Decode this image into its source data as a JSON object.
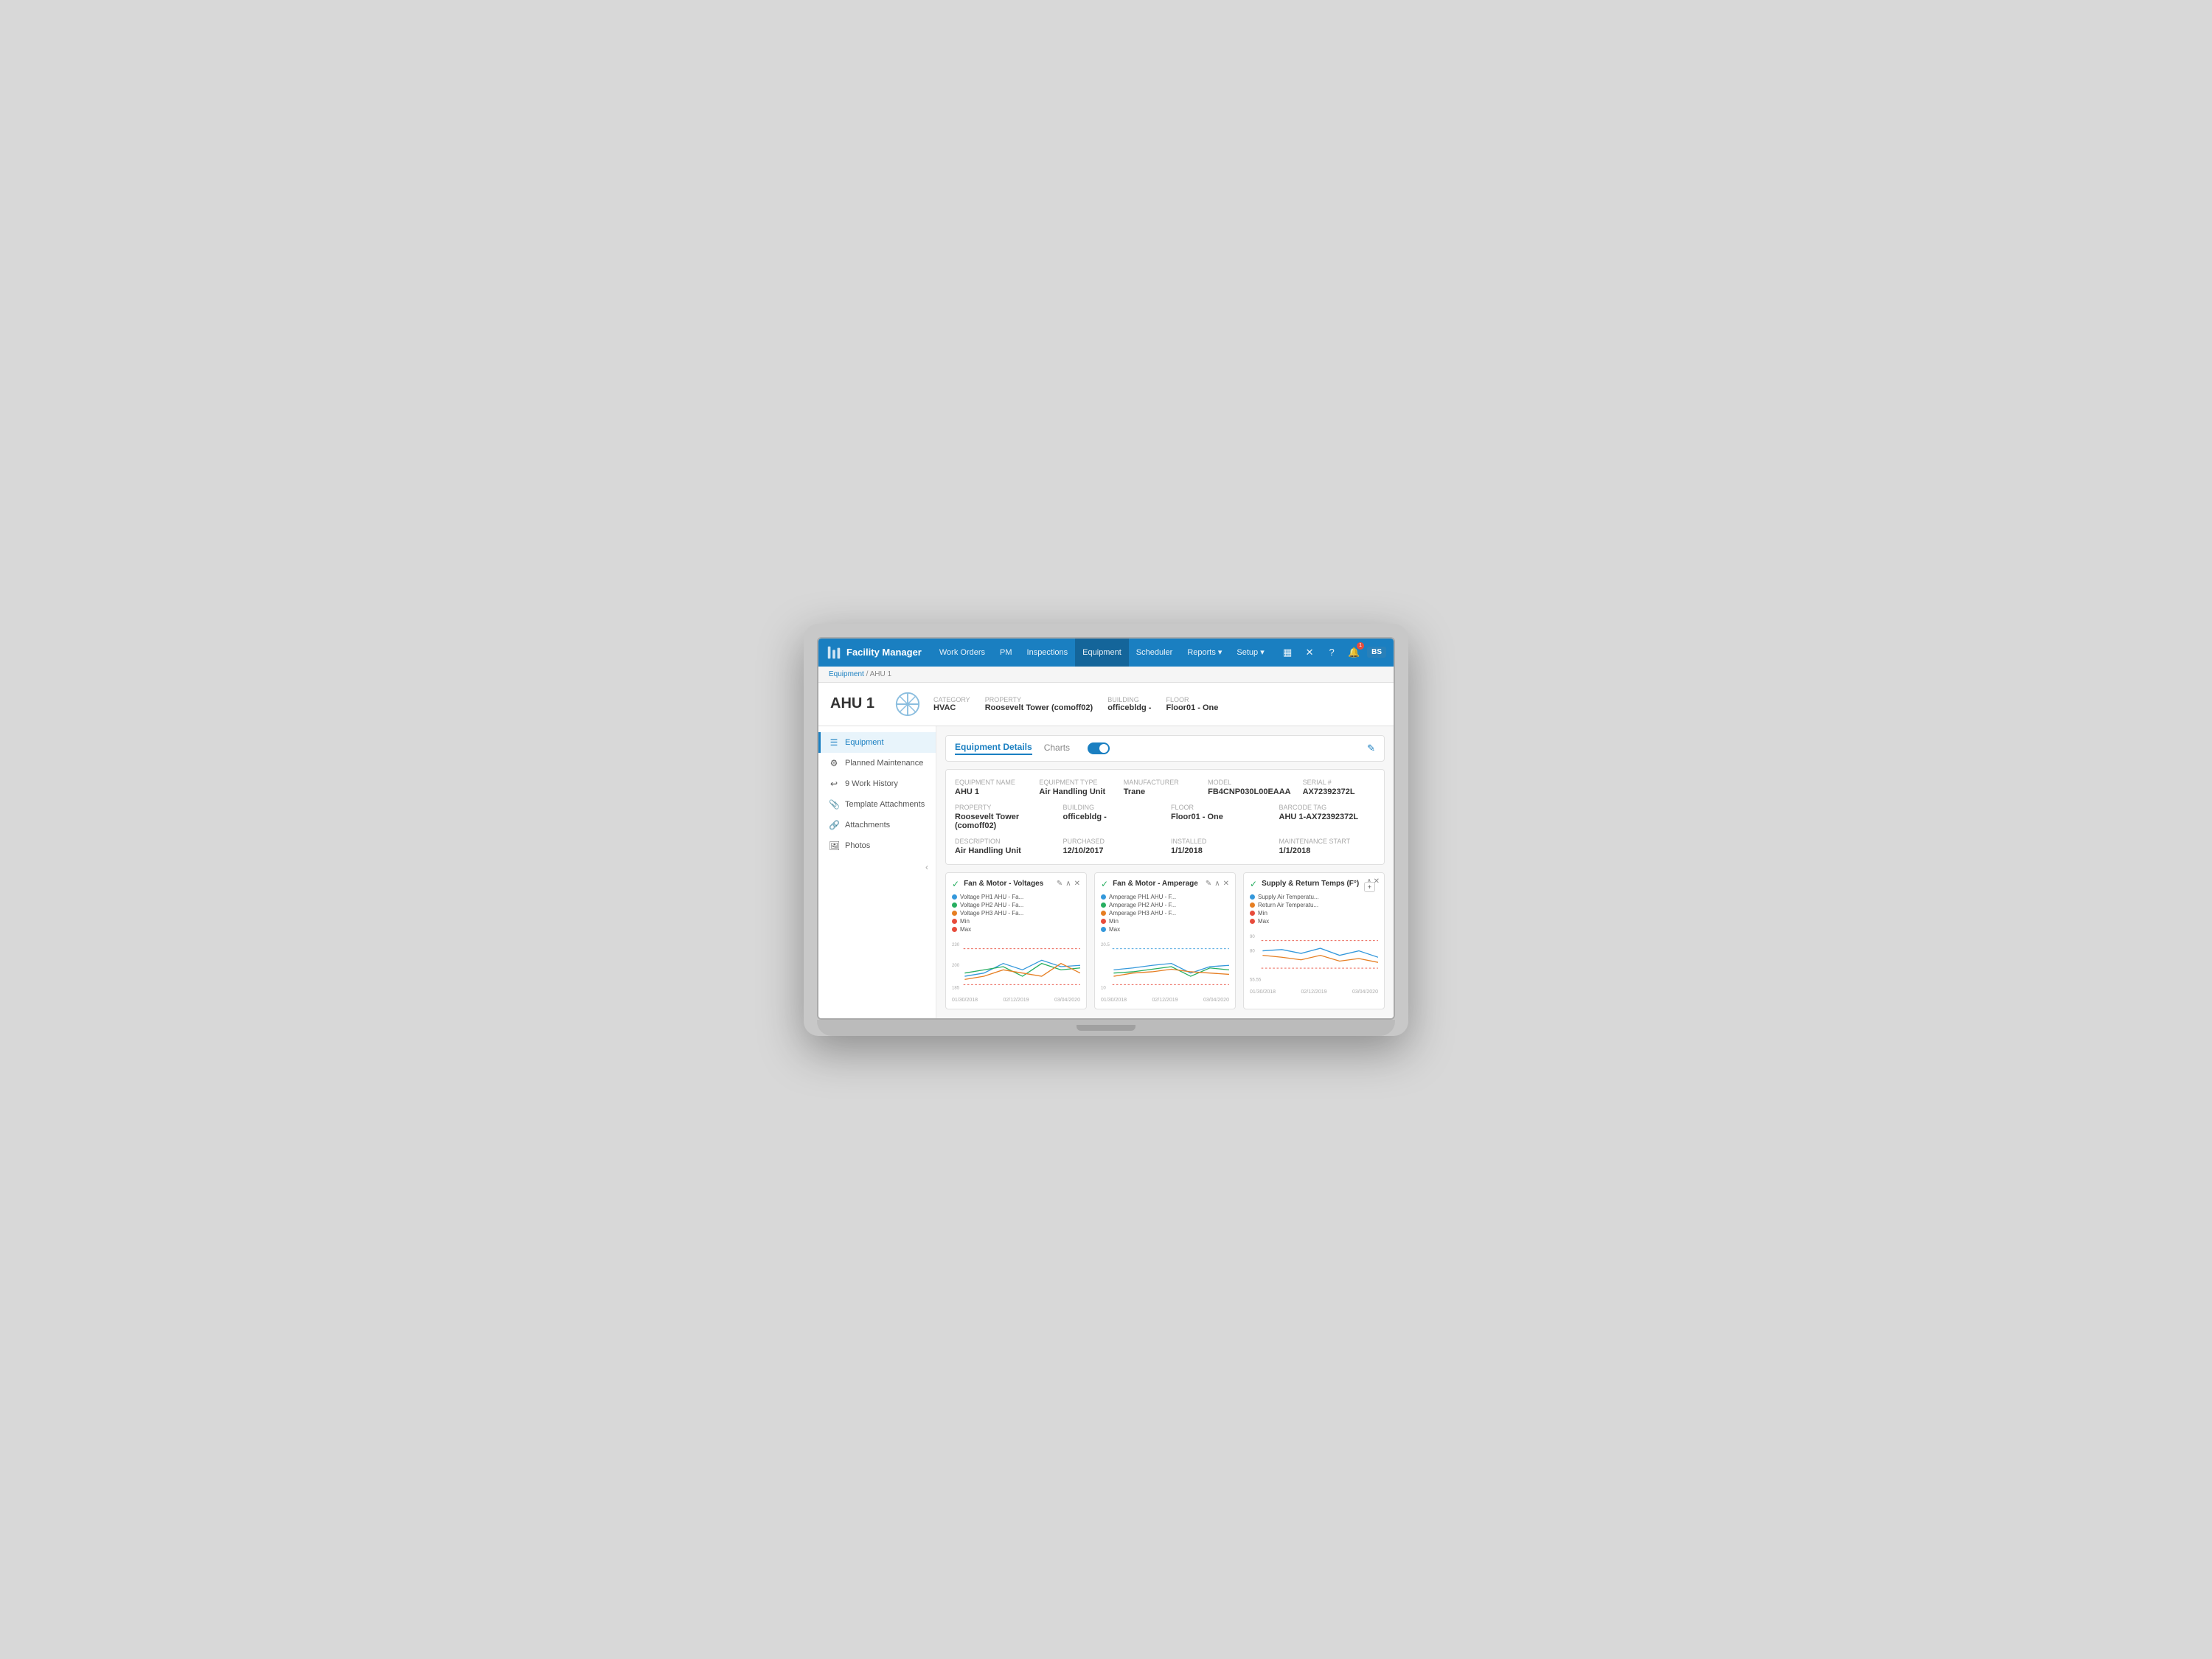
{
  "app": {
    "brand": "Facility Manager",
    "brand_icon": "⛃"
  },
  "nav": {
    "links": [
      {
        "label": "Work Orders",
        "active": false
      },
      {
        "label": "PM",
        "active": false
      },
      {
        "label": "Inspections",
        "active": false
      },
      {
        "label": "Equipment",
        "active": true
      },
      {
        "label": "Scheduler",
        "active": false
      },
      {
        "label": "Reports ▾",
        "active": false
      },
      {
        "label": "Setup ▾",
        "active": false
      }
    ],
    "icons": [
      "▦",
      "✕",
      "?"
    ],
    "notification_count": "1",
    "user_initials": "BS"
  },
  "breadcrumb": {
    "parent": "Equipment",
    "separator": " / ",
    "current": "AHU 1"
  },
  "equipment_header": {
    "title": "AHU 1",
    "category_label": "Category",
    "category_value": "HVAC",
    "property_label": "Property",
    "property_value": "Roosevelt Tower (comoff02)",
    "building_label": "Building",
    "building_value": "officebldg -",
    "floor_label": "Floor",
    "floor_value": "Floor01 - One"
  },
  "sidebar": {
    "items": [
      {
        "label": "Equipment",
        "icon": "☰",
        "active": true
      },
      {
        "label": "Planned Maintenance",
        "icon": "⚙",
        "active": false
      },
      {
        "label": "9 Work History",
        "icon": "↩",
        "active": false
      },
      {
        "label": "Template Attachments",
        "icon": "📎",
        "active": false
      },
      {
        "label": "Attachments",
        "icon": "🔗",
        "active": false
      },
      {
        "label": "Photos",
        "icon": "🖼",
        "active": false
      }
    ],
    "collapse_icon": "‹"
  },
  "tabs": {
    "items": [
      {
        "label": "Equipment Details",
        "active": true
      },
      {
        "label": "Charts",
        "active": false
      }
    ],
    "charts_toggle": true,
    "edit_icon": "✎"
  },
  "details": {
    "row1": [
      {
        "label": "Equipment Name",
        "value": "AHU 1"
      },
      {
        "label": "Equipment Type",
        "value": "Air Handling Unit"
      },
      {
        "label": "Manufacturer",
        "value": "Trane"
      },
      {
        "label": "Model",
        "value": "FB4CNP030L00EAAA"
      },
      {
        "label": "Serial #",
        "value": "AX72392372L"
      }
    ],
    "row2": [
      {
        "label": "Property",
        "value": "Roosevelt Tower (comoff02)"
      },
      {
        "label": "Building",
        "value": "officebldg -"
      },
      {
        "label": "Floor",
        "value": "Floor01 - One"
      },
      {
        "label": "Barcode Tag",
        "value": "AHU 1-AX72392372L"
      }
    ],
    "row3": [
      {
        "label": "Description",
        "value": "Air Handling Unit"
      },
      {
        "label": "Purchased",
        "value": "12/10/2017"
      },
      {
        "label": "Installed",
        "value": "1/1/2018"
      },
      {
        "label": "Maintenance Start",
        "value": "1/1/2018"
      }
    ]
  },
  "charts": [
    {
      "id": "chart1",
      "status": "✓",
      "title": "Fan & Motor - Voltages",
      "legend": [
        {
          "color": "#3498db",
          "label": "Voltage PH1 AHU - Fa..."
        },
        {
          "color": "#27ae60",
          "label": "Voltage PH2 AHU - Fa..."
        },
        {
          "color": "#e67e22",
          "label": "Voltage PH3 AHU - Fa..."
        },
        {
          "color": "#e74c3c",
          "label": "Min"
        },
        {
          "color": "#e74c3c",
          "label": "Max"
        }
      ],
      "y_max": "230",
      "y_mid": "200",
      "y_min": "185",
      "x_labels": [
        "01/30/2018",
        "02/12/2019",
        "03/04/2020"
      ]
    },
    {
      "id": "chart2",
      "status": "✓",
      "title": "Fan & Motor - Amperage",
      "legend": [
        {
          "color": "#3498db",
          "label": "Amperage PH1 AHU - F..."
        },
        {
          "color": "#27ae60",
          "label": "Amperage PH2 AHU - F..."
        },
        {
          "color": "#e67e22",
          "label": "Amperage PH3 AHU - F..."
        },
        {
          "color": "#e74c3c",
          "label": "Min"
        },
        {
          "color": "#3498db",
          "label": "Max"
        }
      ],
      "y_max": "20.5",
      "y_mid": "",
      "y_min": "10",
      "x_labels": [
        "01/30/2018",
        "02/12/2019",
        "03/04/2020"
      ]
    },
    {
      "id": "chart3",
      "status": "✓",
      "title": "Supply & Return Temps (F°)",
      "legend": [
        {
          "color": "#3498db",
          "label": "Supply Air Temperatu..."
        },
        {
          "color": "#e67e22",
          "label": "Return Air Temperatu..."
        },
        {
          "color": "#e74c3c",
          "label": "Min"
        },
        {
          "color": "#e74c3c",
          "label": "Max"
        }
      ],
      "y_max": "90",
      "y_mid": "80",
      "y_min": "55.55",
      "x_labels": [
        "01/30/2018",
        "02/12/2019",
        "03/04/2020"
      ],
      "add_button": "+"
    }
  ]
}
